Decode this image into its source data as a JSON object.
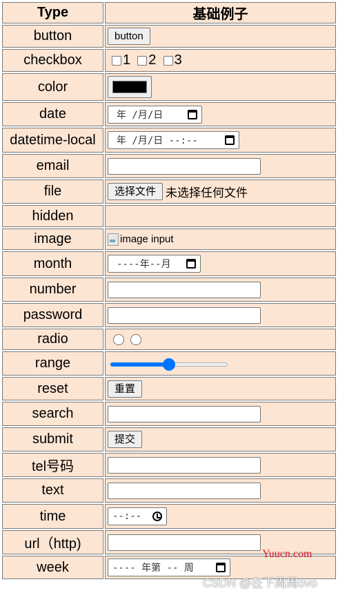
{
  "headers": {
    "type": "Type",
    "example": "基础例子"
  },
  "rows": {
    "button": {
      "type": "button",
      "label": "button"
    },
    "checkbox": {
      "type": "checkbox",
      "options": [
        "1",
        "2",
        "3"
      ]
    },
    "color": {
      "type": "color",
      "value": "#000000"
    },
    "date": {
      "type": "date",
      "placeholder": "年 /月/日"
    },
    "datetime_local": {
      "type": "datetime-local",
      "placeholder": "年 /月/日 --:--"
    },
    "email": {
      "type": "email"
    },
    "file": {
      "type": "file",
      "button": "选择文件",
      "status": "未选择任何文件"
    },
    "hidden": {
      "type": "hidden"
    },
    "image": {
      "type": "image",
      "alt": "image input"
    },
    "month": {
      "type": "month",
      "placeholder": "----年--月"
    },
    "number": {
      "type": "number"
    },
    "password": {
      "type": "password"
    },
    "radio": {
      "type": "radio"
    },
    "range": {
      "type": "range",
      "value_percent": 50
    },
    "reset": {
      "type": "reset",
      "label": "重置"
    },
    "search": {
      "type": "search"
    },
    "submit": {
      "type": "submit",
      "label": "提交"
    },
    "tel": {
      "type": "tel号码"
    },
    "text": {
      "type": "text"
    },
    "time": {
      "type": "time",
      "placeholder": "--:--"
    },
    "url": {
      "type": "url（http)"
    },
    "week": {
      "type": "week",
      "placeholder": "---- 年第 -- 周"
    }
  },
  "watermarks": {
    "yuucn": "Yuucn.com",
    "csdn": "CSDN @在下周周ovo"
  },
  "colors": {
    "cell_bg": "#fde5d3",
    "range_accent": "#0075ff",
    "watermark_red": "#e0182d"
  }
}
